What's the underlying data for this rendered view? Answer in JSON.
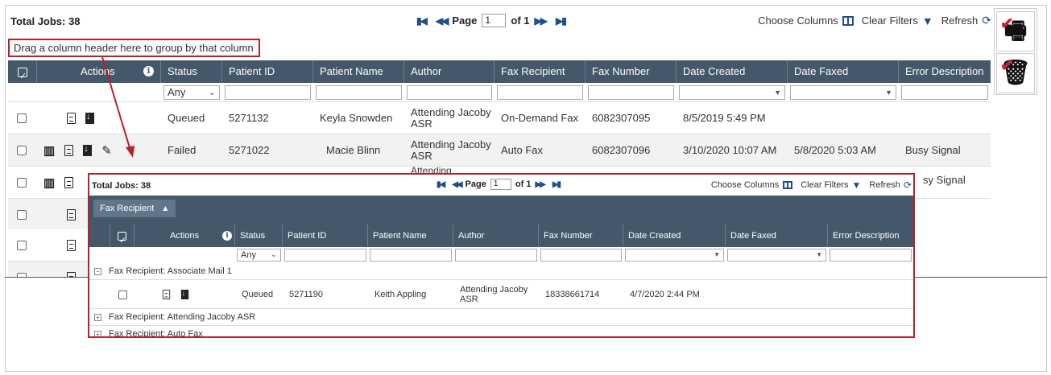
{
  "main": {
    "total_jobs": "Total Jobs: 38",
    "page_label": "Page",
    "page_value": "1",
    "of_label": "of 1",
    "choose_columns": "Choose Columns",
    "clear_filters": "Clear Filters",
    "refresh": "Refresh",
    "group_hint": "Drag a column header here to group by that column",
    "columns": [
      "Actions",
      "Status",
      "Patient ID",
      "Patient Name",
      "Author",
      "Fax Recipient",
      "Fax Number",
      "Date Created",
      "Date Faxed",
      "Error Description"
    ],
    "status_filter": "Any",
    "rows": [
      {
        "status": "Queued",
        "patient_id": "5271132",
        "patient_name": "Keyla Snowden",
        "author": "Attending Jacoby ASR",
        "fax_recipient": "On-Demand Fax",
        "fax_number": "6082307095",
        "date_created": "8/5/2019 5:49 PM",
        "date_faxed": "",
        "error": ""
      },
      {
        "status": "Failed",
        "patient_id": "5271022",
        "patient_name": "Macie Blinn",
        "author": "Attending Jacoby ASR",
        "fax_recipient": "Auto Fax",
        "fax_number": "6082307096",
        "date_created": "3/10/2020 10:07 AM",
        "date_faxed": "5/8/2020 5:03 AM",
        "error": "Busy Signal"
      },
      {
        "author_partial": "Attending",
        "error_partial": "sy Signal"
      }
    ]
  },
  "inset": {
    "total_jobs": "Total Jobs: 38",
    "page_label": "Page",
    "page_value": "1",
    "of_label": "of 1",
    "choose_columns": "Choose Columns",
    "clear_filters": "Clear Filters",
    "refresh": "Refresh",
    "group_chip": "Fax Recipient",
    "columns": [
      "Actions",
      "Status",
      "Patient ID",
      "Patient Name",
      "Author",
      "Fax Number",
      "Date Created",
      "Date Faxed",
      "Error Description"
    ],
    "status_filter": "Any",
    "groups": [
      "Fax Recipient: Associate Mail 1",
      "Fax Recipient: Attending Jacoby ASR",
      "Fax Recipient: Auto Fax"
    ],
    "row": {
      "status": "Queued",
      "patient_id": "5271190",
      "patient_name": "Keith Appling",
      "author": "Attending Jacoby ASR",
      "fax_number": "18338661714",
      "date_created": "4/7/2020 2:44 PM"
    }
  },
  "colors": {
    "header": "#44586a",
    "accent": "#1f4e8c",
    "highlight": "#b2232a"
  },
  "icons": [
    "first-page-icon",
    "prev-page-icon",
    "next-page-icon",
    "last-page-icon",
    "columns-icon",
    "filter-icon",
    "refresh-icon",
    "fax-icon",
    "document-icon",
    "download-icon",
    "edit-icon",
    "info-icon",
    "delete-icon"
  ]
}
